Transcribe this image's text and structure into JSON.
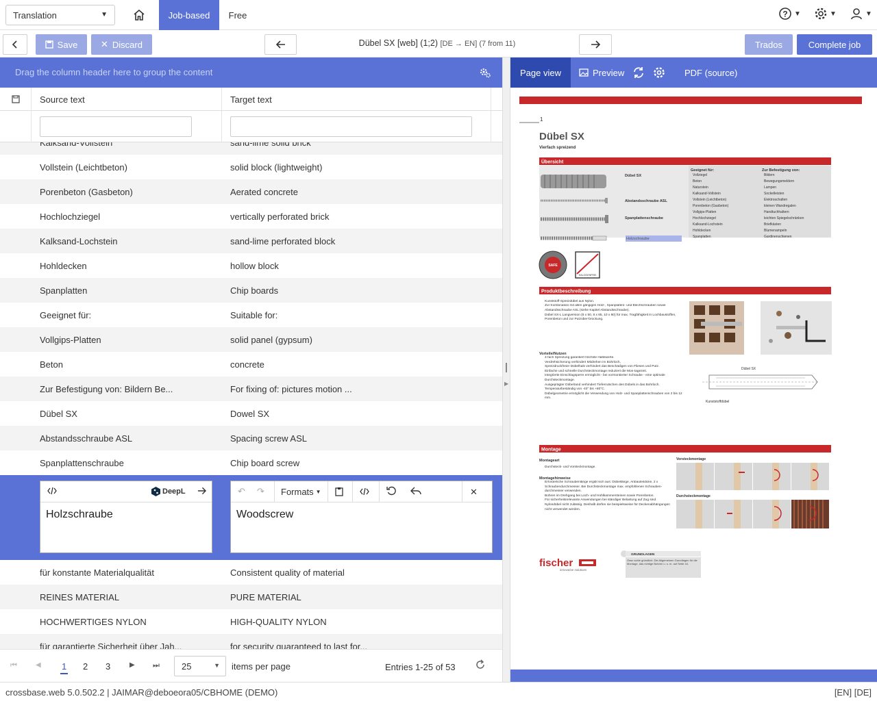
{
  "top": {
    "module_select": "Translation",
    "tabs": [
      "Job-based",
      "Free"
    ]
  },
  "toolbar": {
    "save": "Save",
    "discard": "Discard",
    "title": "Dübel SX [web] (1;2)",
    "title_meta": "[DE → EN] (7 from 11)",
    "trados": "Trados",
    "complete": "Complete job"
  },
  "grid": {
    "group_hint": "Drag the column header here to group the content",
    "col_source": "Source text",
    "col_target": "Target text",
    "rows_top": [
      {
        "s": "Kalksand-Vollstein",
        "t": "sand-lime solid brick"
      },
      {
        "s": "Vollstein (Leichtbeton)",
        "t": "solid block (lightweight)"
      },
      {
        "s": "Porenbeton (Gasbeton)",
        "t": "Aerated concrete"
      },
      {
        "s": "Hochlochziegel",
        "t": "vertically perforated brick"
      },
      {
        "s": "Kalksand-Lochstein",
        "t": "sand-lime perforated block"
      },
      {
        "s": "Hohldecken",
        "t": "hollow block"
      },
      {
        "s": "Spanplatten",
        "t": "Chip boards"
      },
      {
        "s": "Geeignet für:",
        "t": "Suitable for:"
      },
      {
        "s": "Vollgips-Platten",
        "t": "solid panel (gypsum)"
      },
      {
        "s": "Beton",
        "t": "concrete"
      },
      {
        "s": "Zur Befestigung von: Bildern Be...",
        "t": "For fixing of: pictures motion ..."
      },
      {
        "s": "Dübel SX",
        "t": "Dowel SX"
      },
      {
        "s": "Abstandsschraube ASL",
        "t": "Spacing screw ASL"
      },
      {
        "s": "Spanplattenschraube",
        "t": "Chip board screw"
      }
    ],
    "edit": {
      "source": "Holzschraube",
      "target": "Woodscrew",
      "deepl": "DeepL",
      "formats": "Formats"
    },
    "rows_bottom": [
      {
        "s": "für konstante Materialqualität",
        "t": "Consistent quality of material"
      },
      {
        "s": "REINES MATERIAL",
        "t": "PURE MATERIAL"
      },
      {
        "s": "HOCHWERTIGES NYLON",
        "t": "HIGH-QUALITY NYLON"
      },
      {
        "s": "für garantierte Sicherheit über Jah...",
        "t": "for security guaranteed to last for..."
      }
    ],
    "pager": {
      "pages": [
        "1",
        "2",
        "3"
      ],
      "page_size": "25",
      "items_label": "items per page",
      "entries": "Entries 1-25 of 53"
    }
  },
  "preview": {
    "tabs": {
      "page_view": "Page view",
      "preview": "Preview",
      "pdf": "PDF (source)"
    },
    "doc": {
      "page_no": "1",
      "title": "Dübel SX",
      "subtitle": "Vierfach spreizend",
      "sec1": "Übersicht",
      "sec2": "Produktbeschreibung",
      "sec3": "Montage",
      "labels": [
        "Dübel SX",
        "Abstandsschraube ASL",
        "Spanplattenschraube",
        "Holzschraube"
      ],
      "geeignet_head": "Geeignet für:",
      "geeignet": [
        "Vollziegel",
        "Beton",
        "Naturstein",
        "Kalksand-Vollstein",
        "Vollstein (Leichtbeton)",
        "Porenbeton (Gasbeton)",
        "Vollgips-Platten",
        "Hochlochziegel",
        "Kalksand-Lochstein",
        "Hohldecken",
        "Spanplatten"
      ],
      "befest_head": "Zur Befestigung von:",
      "befest": [
        "Bildern",
        "Bewegungsmeldern",
        "Lampen",
        "Sockelleisten",
        "Elektroschalten",
        "kleinen Wandregalen",
        "Handtuchhaltern",
        "leichten Spiegelschränken",
        "Briefkästen",
        "Blumenampeln",
        "Gardinenschienen"
      ],
      "produkt": [
        "Kunststoff-Spreizdübel aus Nylon.",
        "Zur Kombination mit allen gängigen Holz-, Spanplatten- und Blechschrauben sowie Abstandsschraube ASL (siehe Kapitel Abstandsschraube).",
        "Dübel SX-L Langversion (6 x 50, 8 x 65, 10 x 80) für max. Tragfähigkeit in Lochbaustoffen, Porenbeton und zur Putzüber-brückung."
      ],
      "vorteile_head": "Vorteile/Nutzen",
      "vorteile": [
        "4-fach Spreizung garantiert höchste Haltewerte.",
        "Verdrehsicherung verhindert Mitdrehen im Bohrloch.",
        "Spreizdruckfreier Dübelhals verhindert das Beschädigen von Fliesen und Putz.",
        "Einfache und schnelle Durchsteckmontage reduziert die Mon-tagezeit.",
        "Integrierte Einschlagsperre ermöglicht - bei vormontierter Schraube - eine optimale Durchsteckmontage.",
        "Ausgeprägter Dübelrand verhindert Tieferrutschen des Dübels in das Bohrloch.",
        "Temperaturbeständig von -40° bis +80°C.",
        "Dübelgeometrie ermöglicht die Verwendung von Holz- und Spanplattenschrauben von 2 bis 12 mm."
      ],
      "diag_labels": [
        "Dübel SX",
        "Kunststoffdübel"
      ],
      "montageart_head": "Montageart",
      "montageart": "Durchsteck- und Vorsteckmontage.",
      "hinweise_head": "Montagehinweise",
      "hinweise": [
        "Erforderliche Schraubenlänge ergibt sich aus: Dübellänge, Anbauteildicke, 2 x Schraubendurchmesser. Bei Durchsteckmontage max. empfohlenen Schrauben-durchmesser verwenden.",
        "Bohren im Drehgang bei Loch- und Hohlkammersteinen sowie Porenbeton.",
        "Für sicherheitsrelevante Anwendungen bei ständiger Belastung auf Zug sind Nylondübel nicht zulässig. Deshalb dürfen sie beispielsweise für Deckenabhängungen nicht verwendet werden."
      ],
      "vorsteck": "Vorsteckmontage",
      "durchsteck": "Durchsteckmontage",
      "brand": "fischer",
      "brand_tag": "innovative solutions",
      "grundlagen": "GRUNDLAGEN",
      "grundlagen_text": "Gasc sohle gründlich: Die Allgemeinen Grundlagen für die Montage, das richtige Bohren u. s. m. auf Seite 44.",
      "stamp1": "SAFE",
      "stamp2": "HALOGENFREI"
    }
  },
  "status": {
    "left": "crossbase.web 5.0.502.2 | JAIMAR@deboeora05/CBHOME (DEMO)",
    "right": "[EN] [DE]"
  }
}
